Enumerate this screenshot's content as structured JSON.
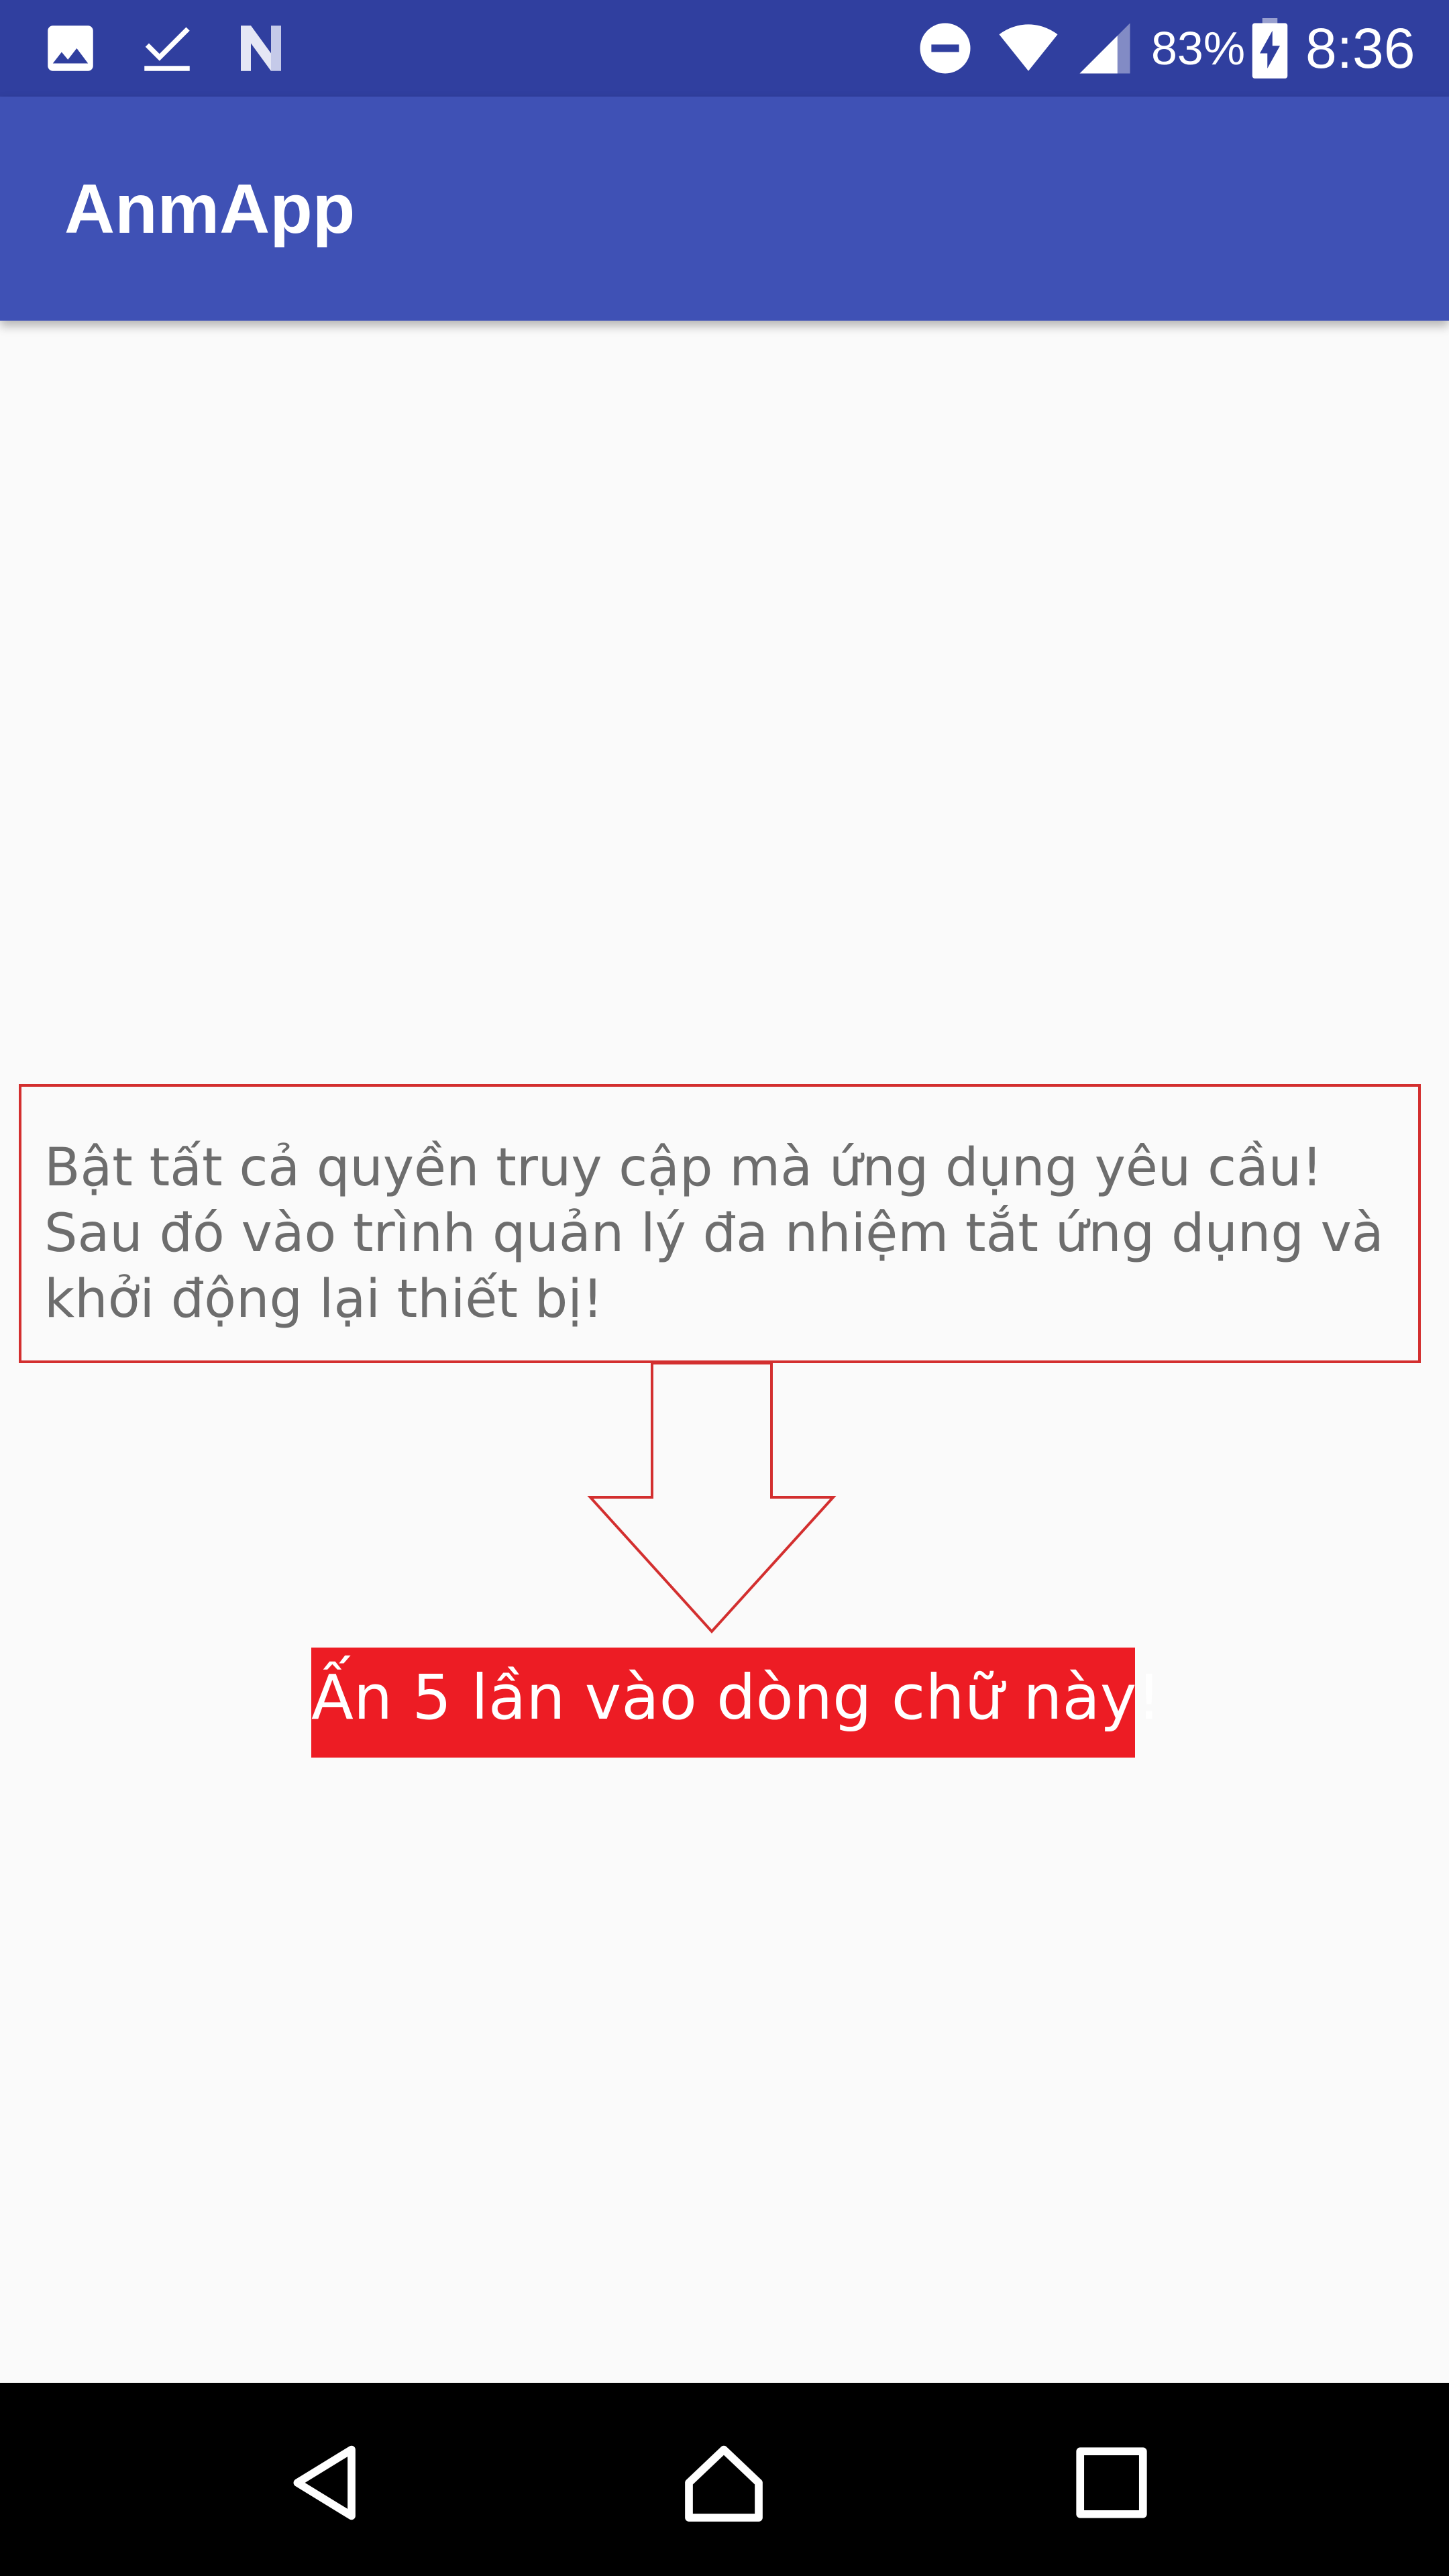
{
  "status_bar": {
    "battery_percent": "83%",
    "time": "8:36",
    "left_icons": [
      "image-notification-icon",
      "checkmark-notification-icon",
      "n-notification-icon"
    ],
    "right_icons": [
      "do-not-disturb-icon",
      "wifi-icon",
      "cell-signal-icon",
      "battery-charging-icon"
    ],
    "background_color": "#303f9f"
  },
  "app_bar": {
    "title": "AnmApp",
    "background_color": "#3f51b5"
  },
  "main": {
    "instruction": "Bật tất cả quyền truy cập mà ứng dụng yêu cầu! Sau đó vào trình quản lý đa nhiệm tắt ứng dụng và khởi động lại thiết bị!",
    "tap_target_label": "Ấn 5 lần vào dòng chữ này!",
    "accent_color": "#ed1c24",
    "border_color": "#d32f2f"
  },
  "nav_bar": {
    "buttons": [
      "back-icon",
      "home-icon",
      "recents-icon"
    ]
  }
}
